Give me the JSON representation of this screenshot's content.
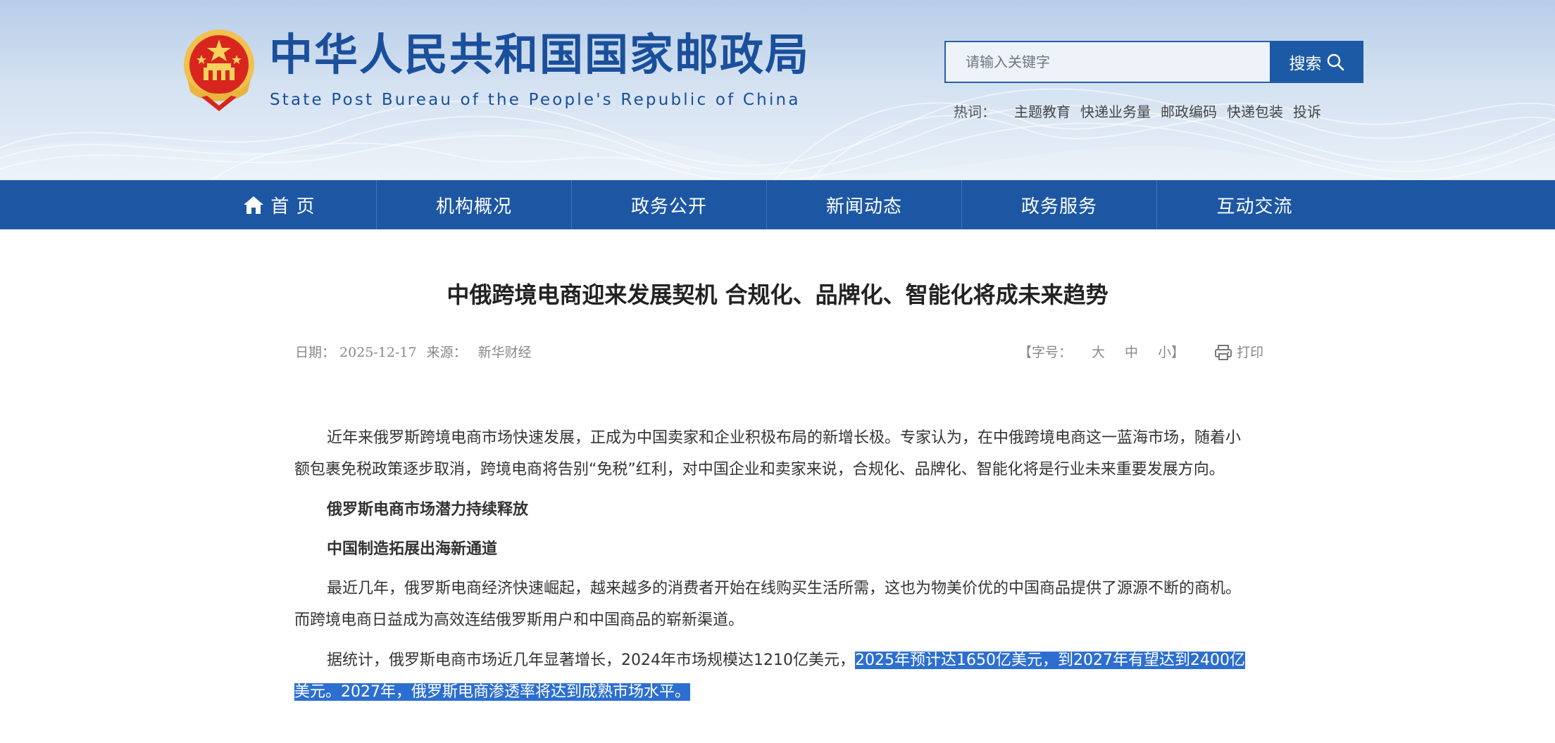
{
  "header": {
    "title_cn": "中华人民共和国国家邮政局",
    "title_en": "State Post Bureau of  the People's Republic of China",
    "search": {
      "placeholder": "请输入关键字",
      "button_label": "搜索"
    },
    "hotwords": {
      "label": "热词：",
      "items": [
        "主题教育",
        "快递业务量",
        "邮政编码",
        "快递包装",
        "投诉"
      ]
    }
  },
  "nav": {
    "items": [
      "首 页",
      "机构概况",
      "政务公开",
      "新闻动态",
      "政务服务",
      "互动交流"
    ]
  },
  "article": {
    "title": "中俄跨境电商迎来发展契机 合规化、品牌化、智能化将成未来趋势",
    "meta": {
      "date_label": "日期：",
      "date": "2025-12-17",
      "source_label": "来源：",
      "source": "新华财经",
      "fontsize_label": "【字号：",
      "fontsize_large": "大",
      "fontsize_medium": "中",
      "fontsize_small": "小】",
      "print_label": "打印"
    },
    "paragraphs": [
      "近年来俄罗斯跨境电商市场快速发展，正成为中国卖家和企业积极布局的新增长极。专家认为，在中俄跨境电商这一蓝海市场，随着小额包裹免税政策逐步取消，跨境电商将告别“免税”红利，对中国企业和卖家来说，合规化、品牌化、智能化将是行业未来重要发展方向。",
      "俄罗斯电商市场潜力持续释放",
      "中国制造拓展出海新通道",
      "最近几年，俄罗斯电商经济快速崛起，越来越多的消费者开始在线购买生活所需，这也为物美价优的中国商品提供了源源不断的商机。而跨境电商日益成为高效连结俄罗斯用户和中国商品的崭新渠道。"
    ],
    "last_paragraph": {
      "plain": "据统计，俄罗斯电商市场近几年显著增长，2024年市场规模达1210亿美元，",
      "selected": "2025年预计达1650亿美元，到2027年有望达到2400亿美元。2027年，俄罗斯电商渗透率将达到成熟市场水平。"
    }
  },
  "colors": {
    "brand_blue": "#1d57a4",
    "selection": "#2d6fd0",
    "title_blue": "#1a4f9c"
  }
}
